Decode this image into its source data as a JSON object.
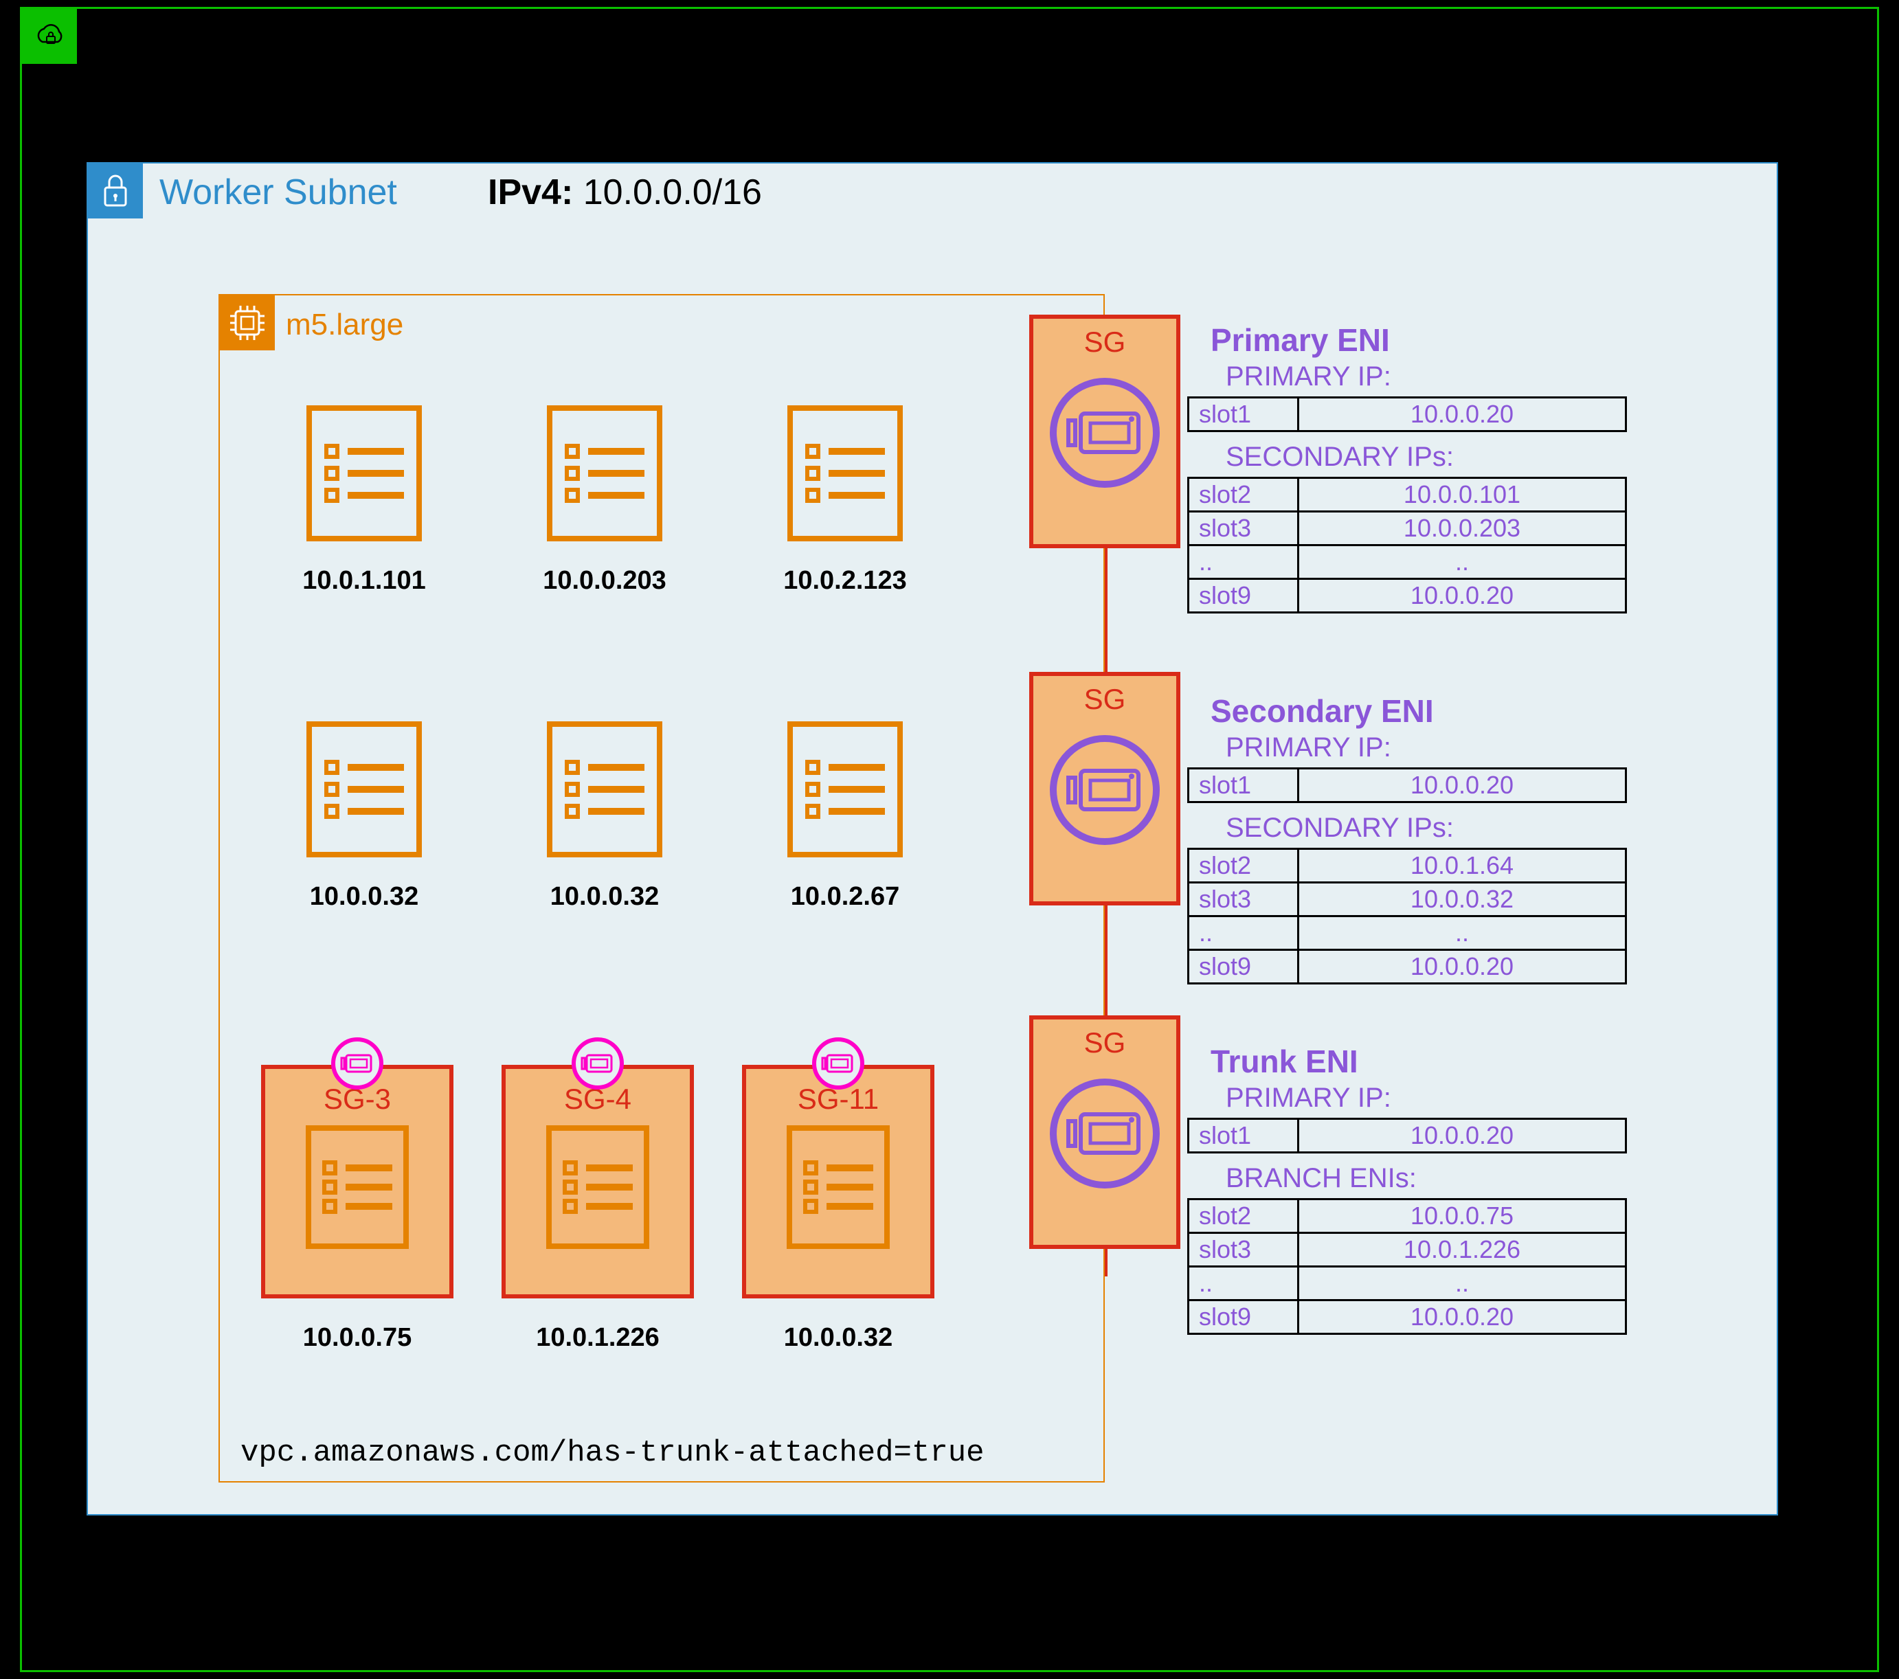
{
  "subnet": {
    "title": "Worker Subnet",
    "cidr_label": "IPv4:",
    "cidr": "10.0.0.0/16"
  },
  "instance": {
    "type_label": "m5.large",
    "annotation": "vpc.amazonaws.com/has-trunk-attached=true"
  },
  "pods_row1": [
    {
      "ip": "10.0.1.101"
    },
    {
      "ip": "10.0.0.203"
    },
    {
      "ip": "10.0.2.123"
    }
  ],
  "pods_row2": [
    {
      "ip": "10.0.0.32"
    },
    {
      "ip": "10.0.0.32"
    },
    {
      "ip": "10.0.2.67"
    }
  ],
  "sg_pods": [
    {
      "sg": "SG-3",
      "ip": "10.0.0.75"
    },
    {
      "sg": "SG-4",
      "ip": "10.0.1.226"
    },
    {
      "sg": "SG-11",
      "ip": "10.0.0.32"
    }
  ],
  "eni_cards": {
    "primary_sg": "SG",
    "secondary_sg": "SG",
    "trunk_sg": "SG"
  },
  "eni_primary": {
    "title": "Primary ENI",
    "primary_label": "PRIMARY IP:",
    "primary_rows": [
      {
        "slot": "slot1",
        "ip": "10.0.0.20"
      }
    ],
    "secondary_label": "SECONDARY IPs:",
    "secondary_rows": [
      {
        "slot": "slot2",
        "ip": "10.0.0.101"
      },
      {
        "slot": "slot3",
        "ip": "10.0.0.203"
      },
      {
        "slot": "..",
        "ip": ".."
      },
      {
        "slot": "slot9",
        "ip": "10.0.0.20"
      }
    ]
  },
  "eni_secondary": {
    "title": "Secondary ENI",
    "primary_label": "PRIMARY IP:",
    "primary_rows": [
      {
        "slot": "slot1",
        "ip": "10.0.0.20"
      }
    ],
    "secondary_label": "SECONDARY IPs:",
    "secondary_rows": [
      {
        "slot": "slot2",
        "ip": "10.0.1.64"
      },
      {
        "slot": "slot3",
        "ip": "10.0.0.32"
      },
      {
        "slot": "..",
        "ip": ".."
      },
      {
        "slot": "slot9",
        "ip": "10.0.0.20"
      }
    ]
  },
  "eni_trunk": {
    "title": "Trunk ENI",
    "primary_label": "PRIMARY IP:",
    "primary_rows": [
      {
        "slot": "slot1",
        "ip": "10.0.0.20"
      }
    ],
    "branch_label": "BRANCH ENIs:",
    "branch_rows": [
      {
        "slot": "slot2",
        "ip": "10.0.0.75"
      },
      {
        "slot": "slot3",
        "ip": "10.0.1.226"
      },
      {
        "slot": "..",
        "ip": ".."
      },
      {
        "slot": "slot9",
        "ip": "10.0.0.20"
      }
    ]
  }
}
